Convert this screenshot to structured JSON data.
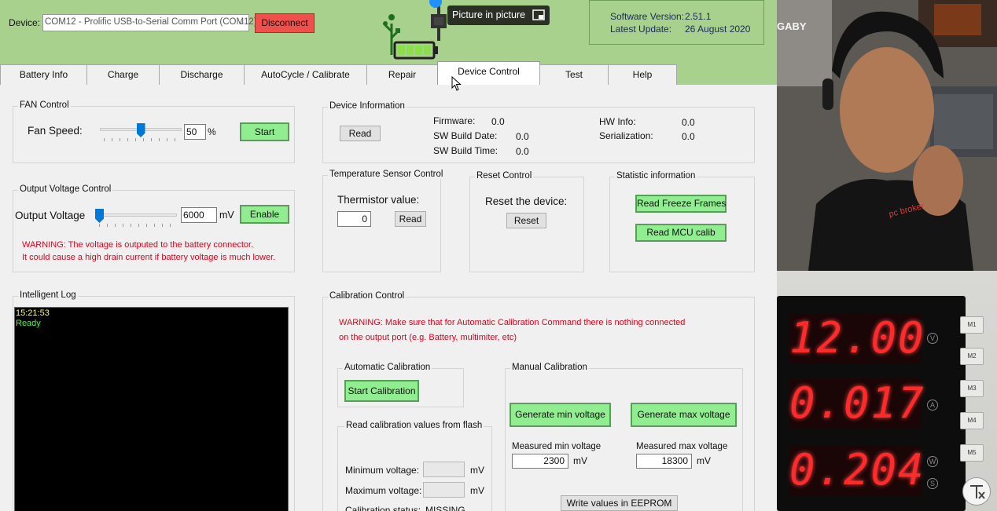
{
  "header": {
    "device_label": "Device:",
    "device_value": "COM12 - Prolific USB-to-Serial Comm Port (COM12)",
    "disconnect_label": "Disconnect",
    "software_version_label": "Software Version:",
    "software_version": "2.51.1",
    "latest_update_label": "Latest Update:",
    "latest_update": "26 August 2020"
  },
  "tabs": [
    {
      "label": "Battery Info"
    },
    {
      "label": "Charge"
    },
    {
      "label": "Discharge"
    },
    {
      "label": "AutoCycle / Calibrate"
    },
    {
      "label": "Repair"
    },
    {
      "label": "Device Control"
    },
    {
      "label": "Test"
    },
    {
      "label": "Help"
    }
  ],
  "fan_control": {
    "title": "FAN Control",
    "speed_label": "Fan Speed:",
    "speed_value": "50",
    "speed_unit": "%",
    "start_label": "Start",
    "slider_level": 0.5
  },
  "output_voltage": {
    "title": "Output Voltage Control",
    "label": "Output Voltage",
    "value": "6000",
    "unit": "mV",
    "enable_label": "Enable",
    "warning_line1": "WARNING: The voltage is outputed to the battery connector.",
    "warning_line2": "It could cause a high drain current if battery voltage is much lower.",
    "slider_level": 0.0
  },
  "log": {
    "title": "Intelligent Log",
    "line1": "15:21:53",
    "line2": "Ready"
  },
  "device_info": {
    "title": "Device Information",
    "read_label": "Read",
    "firmware_label": "Firmware:",
    "firmware": "0.0",
    "sw_build_date_label": "SW Build Date:",
    "sw_build_date": "0.0",
    "sw_build_time_label": "SW Build Time:",
    "sw_build_time": "0.0",
    "hw_info_label": "HW Info:",
    "hw_info": "0.0",
    "serialization_label": "Serialization:",
    "serialization": "0.0"
  },
  "temperature": {
    "title": "Temperature Sensor Control",
    "label": "Thermistor value:",
    "value": "0",
    "read_label": "Read"
  },
  "reset": {
    "title": "Reset Control",
    "label": "Reset the device:",
    "button_label": "Reset"
  },
  "statistic": {
    "title": "Statistic information",
    "freeze_label": "Read Freeze Frames",
    "mcu_label": "Read MCU calib"
  },
  "calibration": {
    "title": "Calibration Control",
    "warning_line1": "WARNING: Make sure that for Automatic Calibration Command there is nothing connected",
    "warning_line2": "on the output port (e.g. Battery, multimiter, etc)",
    "auto_title": "Automatic Calibration",
    "start_label": "Start Calibration",
    "flash_title": "Read calibration values from flash",
    "min_label": "Minimum voltage:",
    "max_label": "Maximum voltage:",
    "unit": "mV",
    "status_label": "Calibration status:",
    "status_value": "MISSING",
    "manual_title": "Manual Calibration",
    "gen_min_label": "Generate min voltage",
    "gen_max_label": "Generate max voltage",
    "measured_min_label": "Measured min voltage",
    "measured_min_value": "2300",
    "measured_max_label": "Measured max voltage",
    "measured_max_value": "18300",
    "write_label": "Write values in EEPROM"
  },
  "overlay": {
    "pip_label": "Picture in picture",
    "shirt_text": "pc broker",
    "poster_text": "GABY"
  },
  "psu": {
    "volts": "12.00",
    "volts_unit": "V",
    "amps": "0.017",
    "amps_unit": "A",
    "watts": "0.204",
    "watts_unit": "W",
    "s_unit": "S",
    "memory_buttons": [
      "M1",
      "M2",
      "M3",
      "M4",
      "M5"
    ]
  },
  "colors": {
    "header_green": "#a9d18e",
    "button_green": "#90ee90",
    "disconnect_red": "#f0504c",
    "warning_red": "#e0001b",
    "led_red": "#ff2a2a"
  }
}
